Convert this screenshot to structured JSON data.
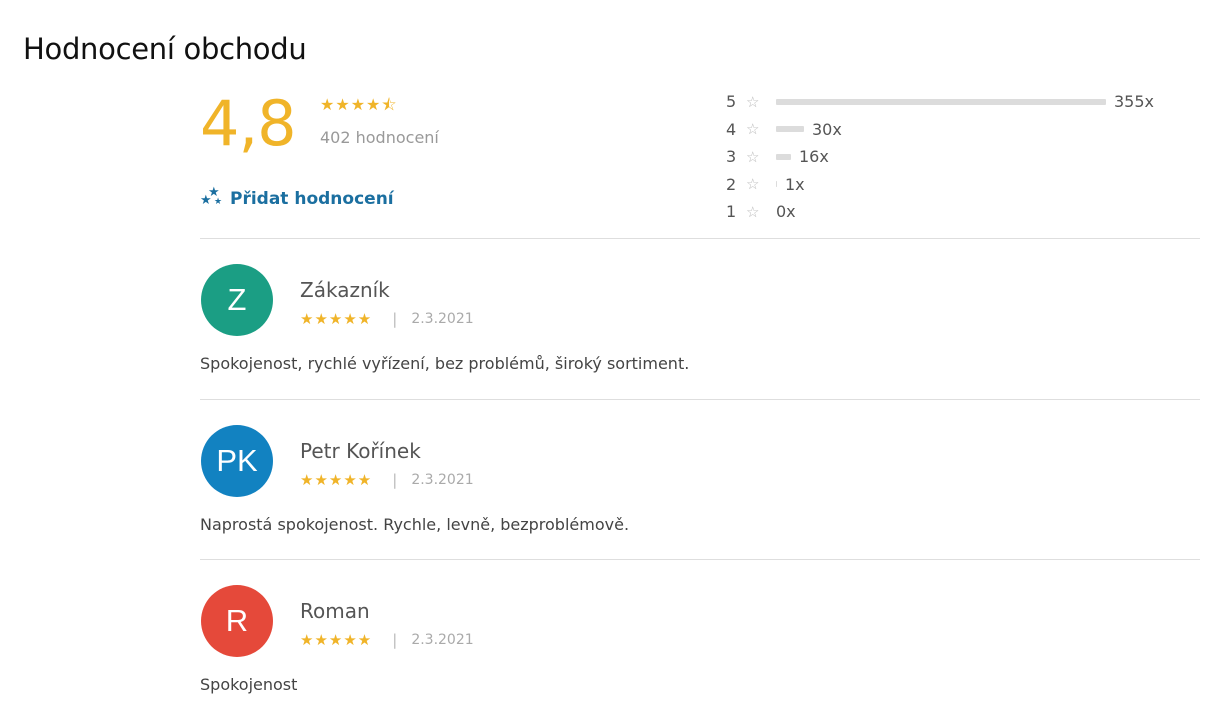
{
  "page": {
    "title": "Hodnocení obchodu"
  },
  "summary": {
    "score": "4,8",
    "stars_text": "★★★★⯪",
    "rating": 4.5,
    "count_text": "402 hodnocení",
    "add_review_label": "Přidat hodnocení"
  },
  "breakdown": [
    {
      "stars": "5",
      "count": "355x",
      "fraction": 0.887
    },
    {
      "stars": "4",
      "count": "30x",
      "fraction": 0.075
    },
    {
      "stars": "3",
      "count": "16x",
      "fraction": 0.04
    },
    {
      "stars": "2",
      "count": "1x",
      "fraction": 0.0025
    },
    {
      "stars": "1",
      "count": "0x",
      "fraction": 0
    }
  ],
  "reviews": [
    {
      "initials": "Z",
      "name": "Zákazník",
      "stars": "★★★★★",
      "rating": 5,
      "separator": "|",
      "date": "2.3.2021",
      "text": "Spokojenost, rychlé vyřízení, bez problémů, široký sortiment.",
      "avatar_color": "#1b9e84"
    },
    {
      "initials": "PK",
      "name": "Petr Kořínek",
      "stars": "★★★★★",
      "rating": 5,
      "separator": "|",
      "date": "2.3.2021",
      "text": "Naprostá spokojenost. Rychle, levně, bezproblémově.",
      "avatar_color": "#1282c1"
    },
    {
      "initials": "R",
      "name": "Roman",
      "stars": "★★★★★",
      "rating": 5,
      "separator": "|",
      "date": "2.3.2021",
      "text": "Spokojenost",
      "avatar_color": "#e5493a"
    }
  ],
  "colors": {
    "accent": "#f0b429",
    "link": "#1b6fa0",
    "bar": "#dcdcdc"
  },
  "icons": {
    "add_review": "stars-icon",
    "star_outline": "star-outline-icon"
  }
}
